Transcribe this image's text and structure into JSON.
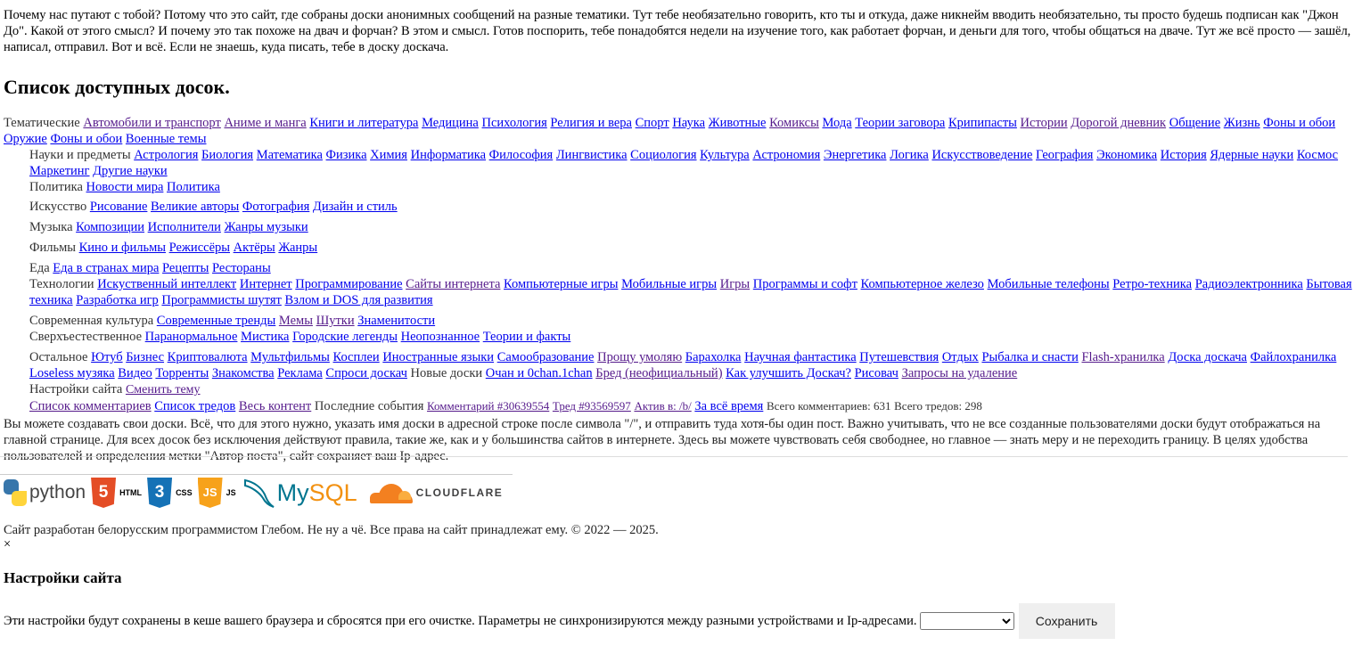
{
  "intro": "Почему нас путают с тобой? Потому что это сайт, где собраны доски анонимных сообщений на разные тематики. Тут тебе необязательно говорить, кто ты и откуда, даже никнейм вводить необязательно, ты просто будешь подписан как \"Джон До\". Какой от этого смысл? И почему это так похоже на двач и форчан? В этом и смысл. Готов поспорить, тебе понадобятся недели на изучение того, как работает форчан, и деньги для того, чтобы общаться на дваче. Тут же всё просто — зашёл, написал, отправил. Вот и всё. Если не знаешь, куда писать, тебе в доску доскача.",
  "boards_title": "Список доступных досок.",
  "categories": {
    "thematic": {
      "label": "Тематические",
      "links": [
        "Автомобили и транспорт",
        "Аниме и манга",
        "Книги и литература",
        "Медицина",
        "Психология",
        "Религия и вера",
        "Спорт",
        "Наука",
        "Животные",
        "Комиксы",
        "Мода",
        "Теории заговора",
        "Крипипасты",
        "Истории",
        "Дорогой дневник",
        "Общение",
        "Жизнь",
        "Фоны и обои",
        "Оружие",
        "Фоны и обои",
        "Военные темы"
      ]
    },
    "science": {
      "label": "Науки и предметы",
      "links": [
        "Астрология",
        "Биология",
        "Математика",
        "Физика",
        "Химия",
        "Информатика",
        "Философия",
        "Лингвистика",
        "Социология",
        "Культура",
        "Астрономия",
        "Энергетика",
        "Логика",
        "Искусствоведение",
        "География",
        "Экономика",
        "История",
        "Ядерные науки",
        "Космос",
        "Маркетинг",
        "Другие науки"
      ]
    },
    "politics": {
      "label": "Политика",
      "links": [
        "Новости мира",
        "Политика"
      ]
    },
    "art": {
      "label": "Искусство",
      "links": [
        "Рисование",
        "Великие авторы",
        "Фотография",
        "Дизайн и стиль"
      ]
    },
    "music": {
      "label": "Музыка",
      "links": [
        "Композиции",
        "Исполнители",
        "Жанры музыки"
      ]
    },
    "films": {
      "label": "Фильмы",
      "links": [
        "Кино и фильмы",
        "Режиссёры",
        "Актёры",
        "Жанры"
      ]
    },
    "food": {
      "label": "Еда",
      "links": [
        "Еда в странах мира",
        "Рецепты",
        "Рестораны"
      ]
    },
    "tech": {
      "label": "Технологии",
      "links": [
        "Искуственный интеллект",
        "Интернет",
        "Программирование",
        "Сайты интернета",
        "Компьютерные игры",
        "Мобильные игры",
        "Игры",
        "Программы и софт",
        "Компьютерное железо",
        "Мобильные телефоны",
        "Ретро-техника",
        "Радиоэлектронника",
        "Бытовая техника",
        "Разработка игр",
        "Программисты шутят",
        "Взлом и DOS для развития"
      ]
    },
    "culture": {
      "label": "Современная культура",
      "links": [
        "Современные тренды",
        "Мемы",
        "Шутки",
        "Знаменитости"
      ]
    },
    "supernatural": {
      "label": "Сверхъестественное",
      "links": [
        "Паранормальное",
        "Мистика",
        "Городские легенды",
        "Неопознанное",
        "Теории и факты"
      ]
    },
    "other": {
      "label": "Остальное",
      "links": [
        "Ютуб",
        "Бизнес",
        "Криптовалюта",
        "Мультфильмы",
        "Косплеи",
        "Иностранные языки",
        "Самообразование",
        "Прощу умоляю",
        "Барахолка",
        "Научная фантастика",
        "Путешевствия",
        "Отдых",
        "Рыбалка и снасти",
        "Flash-хранилка",
        "Доска доскача",
        "Файлохранилка",
        "Loseless музяка",
        "Видео",
        "Торренты",
        "Знакомства",
        "Реклама",
        "Спроси доскач"
      ]
    },
    "new_boards": {
      "label": "Новые доски",
      "links": [
        "Очан и 0chan.1chan",
        "Бред (неофициальный)",
        "Как улучшить Доскач?",
        "Рисовач",
        "Запросы на удаление"
      ]
    }
  },
  "site_settings": {
    "label": "Настройки сайта",
    "link": "Сменить тему"
  },
  "events_row": {
    "links": [
      "Список комментариев",
      "Список тредов",
      "Весь контент"
    ],
    "label": "Последние события",
    "small_links": [
      "Комментарий #30639554",
      "Тред #93569597",
      "Актив в: /b/"
    ],
    "bold_link": "За всё время",
    "stat_comments": "Всего комментариев: 631",
    "stat_threads": "Всего тредов: 298"
  },
  "info": "Вы можете создавать свои доски. Всё, что для этого нужно, указать имя доски в адресной строке после символа \"/\", и отправить туда хотя-бы один пост. Важно учитывать, что не все созданные пользователями доски будут отображаться на главной странице. Для всех досок без исключения действуют правила, такие же, как и у большинства сайтов в интернете. Здесь вы можете чувствовать себя свободнее, но главное — знать меру и не переходить границу. В целях удобства пользователей и определения метки \"Автор поста\", сайт сохраняет ваш Ip-адрес.",
  "logos": {
    "python": "python",
    "html_glyph": "5",
    "html": "HTML",
    "css_glyph": "3",
    "css": "CSS",
    "js_glyph": "JS",
    "js": "JS",
    "my": "My",
    "sql": "SQL",
    "cloudflare": "CLOUDFLARE"
  },
  "credits": "Сайт разработан белорусским программистом Глебом. Не ну а чё. Все права на сайт принадлежат ему. © 2022 — 2025.",
  "close_symbol": "×",
  "settings_title": "Настройки сайта",
  "settings_text": "Эти настройки будут сохранены в кеше вашего браузера и сбросятся при его очистке. Параметры не синхронизируются между разными устройствами и Ip-адресами.",
  "settings_select_value": "",
  "save_label": "Сохранить",
  "colors": {
    "link": "#0000ee",
    "visited": "#551a8b"
  }
}
